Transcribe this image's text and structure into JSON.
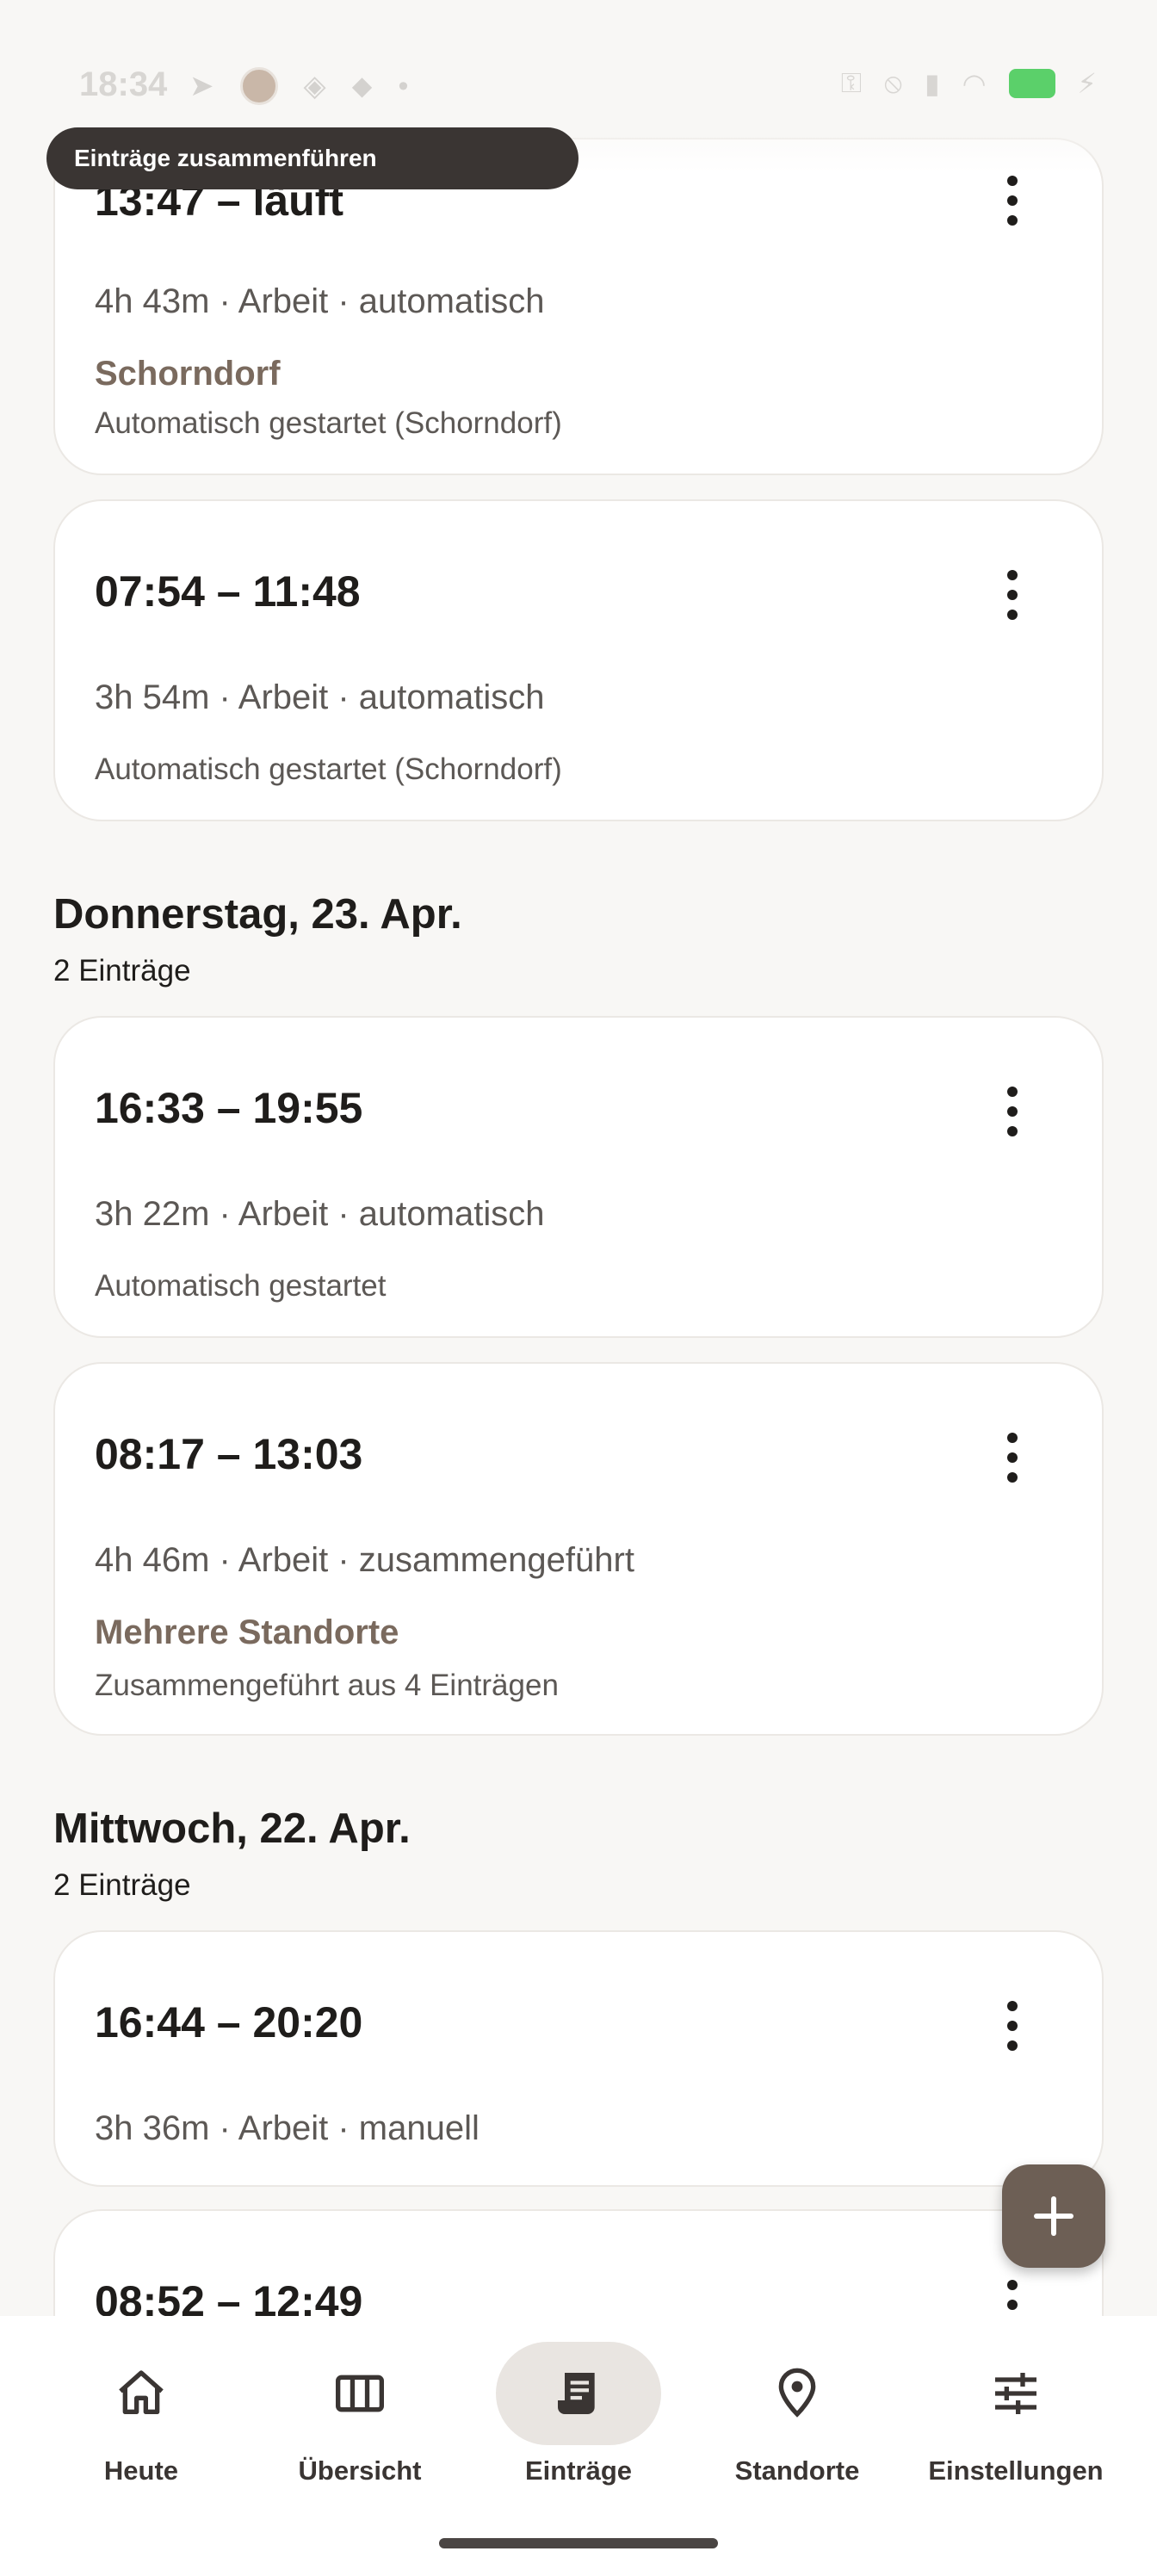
{
  "status_bar": {
    "time": "18:34"
  },
  "tooltip": {
    "text": "Einträge zusammenführen"
  },
  "cards_top": [
    {
      "time": "13:47 – läuft",
      "meta": "4h 43m · Arbeit · automatisch",
      "location": "Schorndorf",
      "note": "Automatisch gestartet (Schorndorf)"
    },
    {
      "time": "07:54 – 11:48",
      "meta": "3h 54m · Arbeit · automatisch",
      "note": "Automatisch gestartet (Schorndorf)"
    }
  ],
  "sections": [
    {
      "title": "Donnerstag, 23. Apr.",
      "count": "2 Einträge",
      "entries": [
        {
          "time": "16:33 – 19:55",
          "meta": "3h 22m · Arbeit · automatisch",
          "note": "Automatisch gestartet"
        },
        {
          "time": "08:17 – 13:03",
          "meta": "4h 46m · Arbeit · zusammengeführt",
          "location": "Mehrere Standorte",
          "note": "Zusammengeführt aus 4 Einträgen"
        }
      ]
    },
    {
      "title": "Mittwoch, 22. Apr.",
      "count": "2 Einträge",
      "entries": [
        {
          "time": "16:44 – 20:20",
          "meta": "3h 36m · Arbeit · manuell"
        },
        {
          "time": "08:52 – 12:49"
        }
      ]
    }
  ],
  "nav": [
    {
      "label": "Heute",
      "icon": "home-icon"
    },
    {
      "label": "Übersicht",
      "icon": "columns-icon"
    },
    {
      "label": "Einträge",
      "icon": "receipt-icon",
      "active": true
    },
    {
      "label": "Standorte",
      "icon": "location-pin-icon"
    },
    {
      "label": "Einstellungen",
      "icon": "sliders-icon"
    }
  ],
  "colors": {
    "accent": "#6d5f55",
    "location_text": "#7a6a5e",
    "background": "#f8f7f5"
  }
}
